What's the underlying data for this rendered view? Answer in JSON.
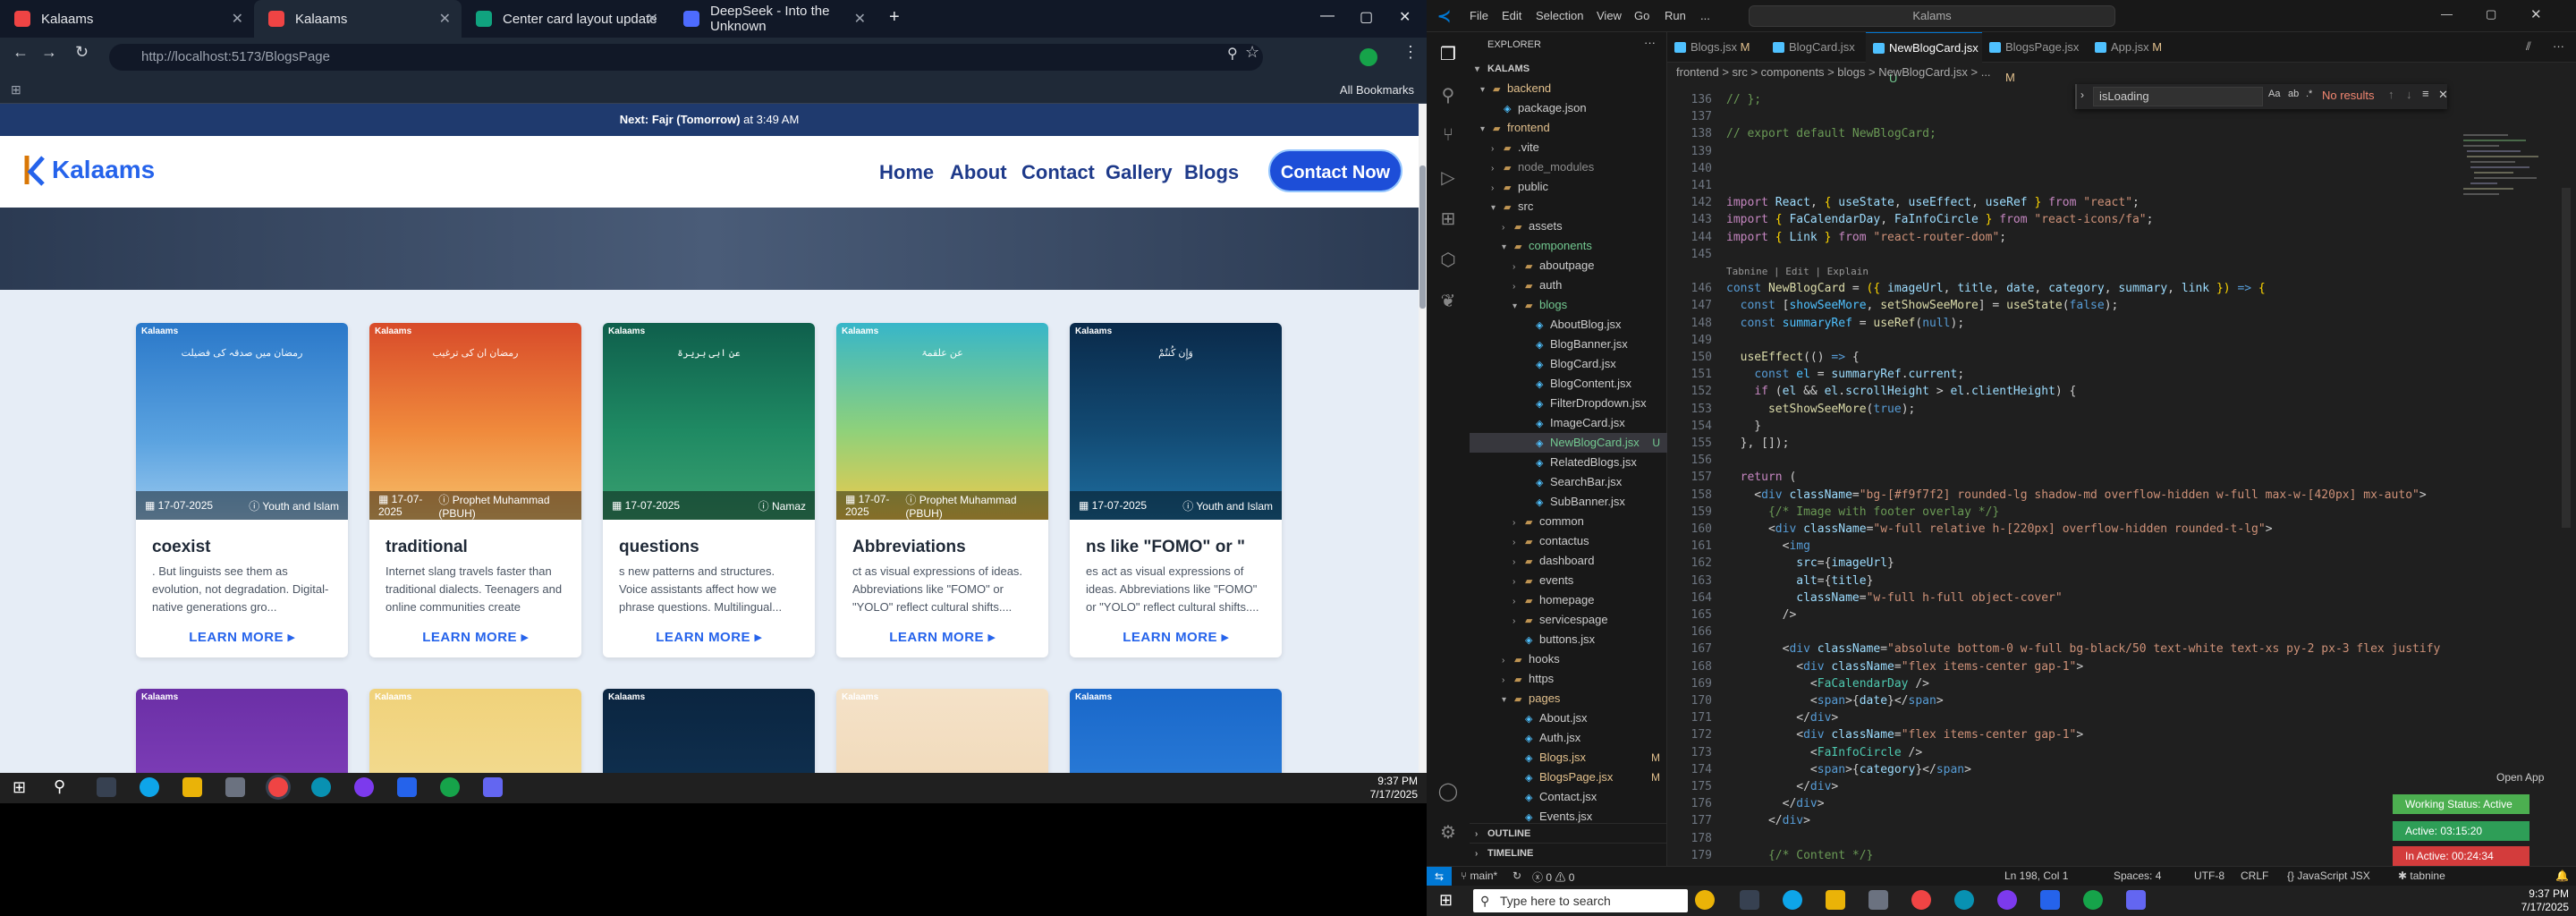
{
  "browser": {
    "tabs": [
      {
        "label": "Kalaams",
        "active": false
      },
      {
        "label": "Kalaams",
        "active": true
      },
      {
        "label": "Center card layout update",
        "active": false
      },
      {
        "label": "DeepSeek - Into the Unknown",
        "active": false
      }
    ],
    "url": "http://localhost:5173/BlogsPage",
    "bookmarks_label": "All Bookmarks"
  },
  "site": {
    "notice_prefix": "Next: Fajr (Tomorrow)",
    "notice_suffix": " at 3:49 AM",
    "logo_text": "Kalaams",
    "nav": [
      "Home",
      "About",
      "Contact",
      "Gallery",
      "Blogs"
    ],
    "contact_button": "Contact Now",
    "learn_more": "LEARN MORE ▸",
    "cards": [
      {
        "title": "coexist",
        "summary": ". But linguists see them as evolution, not degradation. Digital-native generations gro...",
        "date": "17-07-2025",
        "category": "Youth and Islam",
        "arabic": "رمضان میں صدقہ کی فضیلت",
        "bg": "linear-gradient(180deg,#2a78c9,#5ba3e0 60%,#9ac9ef)"
      },
      {
        "title": "traditional",
        "summary": "Internet slang travels faster than traditional dialects. Teenagers and online communities create",
        "date": "17-07-2025",
        "category": "Prophet Muhammad (PBUH)",
        "arabic": "رمضان ان کی ترغیب",
        "bg": "linear-gradient(180deg,#d84b2a,#f08a3c 55%,#f6c06b)"
      },
      {
        "title": "questions",
        "summary": "s new patterns and structures. Voice assistants affect how we phrase questions. Multilingual...",
        "date": "17-07-2025",
        "category": "Namaz",
        "arabic": "عن ابی ہریرۃ",
        "bg": "linear-gradient(180deg,#0f5f4c,#1f8a63 55%,#3aa070)"
      },
      {
        "title": "Abbreviations",
        "summary": "ct as visual expressions of ideas. Abbreviations like \"FOMO\" or \"YOLO\" reflect cultural shifts....",
        "date": "17-07-2025",
        "category": "Prophet Muhammad (PBUH)",
        "arabic": "عن علقمۃ",
        "bg": "linear-gradient(180deg,#37b6c9,#8fd17a 55%,#f3c94a)"
      },
      {
        "title": "ns like \"FOMO\" or \"",
        "summary": "es act as visual expressions of ideas. Abbreviations like \"FOMO\" or \"YOLO\" reflect cultural shifts....",
        "date": "17-07-2025",
        "category": "Youth and Islam",
        "arabic": "وَإِن كُنتُمْ",
        "bg": "linear-gradient(180deg,#0a2a4a,#124a73 55%,#1e6ea0)"
      }
    ],
    "row2_bgs": [
      "linear-gradient(180deg,#6b2fa6,#8f4cc8)",
      "linear-gradient(180deg,#f0d27a,#f6e3a5)",
      "linear-gradient(180deg,#0b2540,#133a5e)",
      "linear-gradient(180deg,#f4e2c8,#efd2ad)",
      "linear-gradient(180deg,#1967c9,#3a8fe6)"
    ]
  },
  "taskbar_left": {
    "time": "9:37 PM",
    "date": "7/17/2025"
  },
  "vscode": {
    "menu": [
      "File",
      "Edit",
      "Selection",
      "View",
      "Go",
      "Run",
      "..."
    ],
    "command_center": "Kalams",
    "explorer_title": "EXPLORER",
    "project": "KALAMS",
    "tabs": [
      {
        "label": "Blogs.jsx",
        "mark": "M",
        "active": false
      },
      {
        "label": "BlogCard.jsx",
        "mark": "",
        "active": false
      },
      {
        "label": "NewBlogCard.jsx",
        "mark": "U",
        "active": true
      },
      {
        "label": "BlogsPage.jsx",
        "mark": "M",
        "active": false
      },
      {
        "label": "App.jsx",
        "mark": "M",
        "active": false
      }
    ],
    "breadcrumb": "frontend > src > components > blogs > NewBlogCard.jsx > ...",
    "find_value": "isLoading",
    "find_result": "No results",
    "tree": [
      {
        "label": "backend",
        "depth": 1,
        "type": "folder",
        "open": true,
        "color": "#e2c08d"
      },
      {
        "label": "package.json",
        "depth": 2,
        "type": "file",
        "open": false,
        "color": "#ccc"
      },
      {
        "label": "frontend",
        "depth": 1,
        "type": "folder",
        "open": true,
        "color": "#e2c08d"
      },
      {
        "label": ".vite",
        "depth": 2,
        "type": "folder",
        "open": false,
        "color": "#ccc"
      },
      {
        "label": "node_modules",
        "depth": 2,
        "type": "folder",
        "open": false,
        "color": "#8b8b8b"
      },
      {
        "label": "public",
        "depth": 2,
        "type": "folder",
        "open": false,
        "color": "#ccc"
      },
      {
        "label": "src",
        "depth": 2,
        "type": "folder",
        "open": true,
        "color": "#ccc"
      },
      {
        "label": "assets",
        "depth": 3,
        "type": "folder",
        "open": false,
        "color": "#ccc"
      },
      {
        "label": "components",
        "depth": 3,
        "type": "folder",
        "open": true,
        "color": "#73c991"
      },
      {
        "label": "aboutpage",
        "depth": 4,
        "type": "folder",
        "open": false,
        "color": "#ccc"
      },
      {
        "label": "auth",
        "depth": 4,
        "type": "folder",
        "open": false,
        "color": "#ccc"
      },
      {
        "label": "blogs",
        "depth": 4,
        "type": "folder",
        "open": true,
        "color": "#73c991"
      },
      {
        "label": "AboutBlog.jsx",
        "depth": 5,
        "type": "file",
        "open": false,
        "color": "#ccc"
      },
      {
        "label": "BlogBanner.jsx",
        "depth": 5,
        "type": "file",
        "open": false,
        "color": "#ccc"
      },
      {
        "label": "BlogCard.jsx",
        "depth": 5,
        "type": "file",
        "open": false,
        "color": "#ccc"
      },
      {
        "label": "BlogContent.jsx",
        "depth": 5,
        "type": "file",
        "open": false,
        "color": "#ccc"
      },
      {
        "label": "FilterDropdown.jsx",
        "depth": 5,
        "type": "file",
        "open": false,
        "color": "#ccc"
      },
      {
        "label": "ImageCard.jsx",
        "depth": 5,
        "type": "file",
        "open": false,
        "color": "#ccc"
      },
      {
        "label": "NewBlogCard.jsx",
        "depth": 5,
        "type": "file",
        "open": false,
        "color": "#73c991",
        "badge": "U",
        "selected": true
      },
      {
        "label": "RelatedBlogs.jsx",
        "depth": 5,
        "type": "file",
        "open": false,
        "color": "#ccc"
      },
      {
        "label": "SearchBar.jsx",
        "depth": 5,
        "type": "file",
        "open": false,
        "color": "#ccc"
      },
      {
        "label": "SubBanner.jsx",
        "depth": 5,
        "type": "file",
        "open": false,
        "color": "#ccc"
      },
      {
        "label": "common",
        "depth": 4,
        "type": "folder",
        "open": false,
        "color": "#ccc"
      },
      {
        "label": "contactus",
        "depth": 4,
        "type": "folder",
        "open": false,
        "color": "#ccc"
      },
      {
        "label": "dashboard",
        "depth": 4,
        "type": "folder",
        "open": false,
        "color": "#ccc"
      },
      {
        "label": "events",
        "depth": 4,
        "type": "folder",
        "open": false,
        "color": "#ccc"
      },
      {
        "label": "homepage",
        "depth": 4,
        "type": "folder",
        "open": false,
        "color": "#ccc"
      },
      {
        "label": "servicespage",
        "depth": 4,
        "type": "folder",
        "open": false,
        "color": "#ccc"
      },
      {
        "label": "buttons.jsx",
        "depth": 4,
        "type": "file",
        "open": false,
        "color": "#ccc"
      },
      {
        "label": "hooks",
        "depth": 3,
        "type": "folder",
        "open": false,
        "color": "#ccc"
      },
      {
        "label": "https",
        "depth": 3,
        "type": "folder",
        "open": false,
        "color": "#ccc"
      },
      {
        "label": "pages",
        "depth": 3,
        "type": "folder",
        "open": true,
        "color": "#e2c08d"
      },
      {
        "label": "About.jsx",
        "depth": 4,
        "type": "file",
        "open": false,
        "color": "#ccc"
      },
      {
        "label": "Auth.jsx",
        "depth": 4,
        "type": "file",
        "open": false,
        "color": "#ccc"
      },
      {
        "label": "Blogs.jsx",
        "depth": 4,
        "type": "file",
        "open": false,
        "color": "#e2c08d",
        "badge": "M"
      },
      {
        "label": "BlogsPage.jsx",
        "depth": 4,
        "type": "file",
        "open": false,
        "color": "#e2c08d",
        "badge": "M"
      },
      {
        "label": "Contact.jsx",
        "depth": 4,
        "type": "file",
        "open": false,
        "color": "#ccc"
      },
      {
        "label": "Events.jsx",
        "depth": 4,
        "type": "file",
        "open": false,
        "color": "#ccc"
      }
    ],
    "outline_label": "OUTLINE",
    "timeline_label": "TIMELINE",
    "code_lines": [
      {
        "n": "136",
        "html": "<span class='cm'>// };</span>"
      },
      {
        "n": "137",
        "html": ""
      },
      {
        "n": "138",
        "html": "<span class='cm'>// export default NewBlogCard;</span>"
      },
      {
        "n": "139",
        "html": ""
      },
      {
        "n": "140",
        "html": ""
      },
      {
        "n": "141",
        "html": ""
      },
      {
        "n": "142",
        "html": "<span class='kw'>import</span> <span class='vr'>React</span>, <span class='br'>{</span> <span class='vr'>useState</span>, <span class='vr'>useEffect</span>, <span class='vr'>useRef</span> <span class='br'>}</span> <span class='kw'>from</span> <span class='st'>\"react\"</span>;"
      },
      {
        "n": "143",
        "html": "<span class='kw'>import</span> <span class='br'>{</span> <span class='vr'>FaCalendarDay</span>, <span class='vr'>FaInfoCircle</span> <span class='br'>}</span> <span class='kw'>from</span> <span class='st'>\"react-icons/fa\"</span>;"
      },
      {
        "n": "144",
        "html": "<span class='kw'>import</span> <span class='br'>{</span> <span class='vr'>Link</span> <span class='br'>}</span> <span class='kw'>from</span> <span class='st'>\"react-router-dom\"</span>;"
      },
      {
        "n": "145",
        "html": ""
      },
      {
        "n": "lens",
        "html": "<span id='lens'>Tabnine | Edit | Explain</span>"
      },
      {
        "n": "146",
        "html": "<span class='kb'>const</span> <span class='fn'>NewBlogCard</span> = <span class='br'>(</span><span class='br'>{</span> <span class='vr'>imageUrl</span>, <span class='vr'>title</span>, <span class='vr'>date</span>, <span class='vr'>category</span>, <span class='vr'>summary</span>, <span class='vr'>link</span> <span class='br'>}</span><span class='br'>)</span> <span class='kb'>=&gt;</span> <span class='br'>{</span>"
      },
      {
        "n": "147",
        "html": "  <span class='kb'>const</span> [<span class='co'>showSeeMore</span>, <span class='fn'>setShowSeeMore</span>] = <span class='fn'>useState</span>(<span class='kb'>false</span>);"
      },
      {
        "n": "148",
        "html": "  <span class='kb'>const</span> <span class='co'>summaryRef</span> = <span class='fn'>useRef</span>(<span class='kb'>null</span>);"
      },
      {
        "n": "149",
        "html": ""
      },
      {
        "n": "150",
        "html": "  <span class='fn'>useEffect</span>(() <span class='kb'>=&gt;</span> {"
      },
      {
        "n": "151",
        "html": "    <span class='kb'>const</span> <span class='co'>el</span> = <span class='vr'>summaryRef</span>.<span class='vr'>current</span>;"
      },
      {
        "n": "152",
        "html": "    <span class='kw'>if</span> (<span class='vr'>el</span> &amp;&amp; <span class='vr'>el</span>.<span class='vr'>scrollHeight</span> &gt; <span class='vr'>el</span>.<span class='vr'>clientHeight</span>) {"
      },
      {
        "n": "153",
        "html": "      <span class='fn'>setShowSeeMore</span>(<span class='kb'>true</span>);"
      },
      {
        "n": "154",
        "html": "    }"
      },
      {
        "n": "155",
        "html": "  }, []);"
      },
      {
        "n": "156",
        "html": ""
      },
      {
        "n": "157",
        "html": "  <span class='kw'>return</span> ("
      },
      {
        "n": "158",
        "html": "    &lt;<span class='kb'>div</span> <span class='at'>className</span>=<span class='st'>\"bg-[#f9f7f2] rounded-lg shadow-md overflow-hidden w-full max-w-[420px] mx-auto\"</span>&gt;"
      },
      {
        "n": "159",
        "html": "      <span class='cm'>{/* Image with footer overlay */}</span>"
      },
      {
        "n": "160",
        "html": "      &lt;<span class='kb'>div</span> <span class='at'>className</span>=<span class='st'>\"w-full relative h-[220px] overflow-hidden rounded-t-lg\"</span>&gt;"
      },
      {
        "n": "161",
        "html": "        &lt;<span class='kb'>img</span>"
      },
      {
        "n": "162",
        "html": "          <span class='at'>src</span>={<span class='vr'>imageUrl</span>}"
      },
      {
        "n": "163",
        "html": "          <span class='at'>alt</span>={<span class='vr'>title</span>}"
      },
      {
        "n": "164",
        "html": "          <span class='at'>className</span>=<span class='st'>\"w-full h-full object-cover\"</span>"
      },
      {
        "n": "165",
        "html": "        /&gt;"
      },
      {
        "n": "166",
        "html": ""
      },
      {
        "n": "167",
        "html": "        &lt;<span class='kb'>div</span> <span class='at'>className</span>=<span class='st'>\"absolute bottom-0 w-full bg-black/50 text-white text-xs py-2 px-3 flex justify</span>"
      },
      {
        "n": "168",
        "html": "          &lt;<span class='kb'>div</span> <span class='at'>className</span>=<span class='st'>\"flex items-center gap-1\"</span>&gt;"
      },
      {
        "n": "169",
        "html": "            &lt;<span class='tg'>FaCalendarDay</span> /&gt;"
      },
      {
        "n": "170",
        "html": "            &lt;<span class='kb'>span</span>&gt;{<span class='vr'>date</span>}&lt;/<span class='kb'>span</span>&gt;"
      },
      {
        "n": "171",
        "html": "          &lt;/<span class='kb'>div</span>&gt;"
      },
      {
        "n": "172",
        "html": "          &lt;<span class='kb'>div</span> <span class='at'>className</span>=<span class='st'>\"flex items-center gap-1\"</span>&gt;"
      },
      {
        "n": "173",
        "html": "            &lt;<span class='tg'>FaInfoCircle</span> /&gt;"
      },
      {
        "n": "174",
        "html": "            &lt;<span class='kb'>span</span>&gt;{<span class='vr'>category</span>}&lt;/<span class='kb'>span</span>&gt;"
      },
      {
        "n": "175",
        "html": "          &lt;/<span class='kb'>div</span>&gt;"
      },
      {
        "n": "176",
        "html": "        &lt;/<span class='kb'>div</span>&gt;"
      },
      {
        "n": "177",
        "html": "      &lt;/<span class='kb'>div</span>&gt;"
      },
      {
        "n": "178",
        "html": ""
      },
      {
        "n": "179",
        "html": "      <span class='cm'>{/* Content */}</span>"
      }
    ],
    "status": {
      "branch": "main*",
      "errors": "0",
      "warnings": "0",
      "position": "Ln 198, Col 1",
      "spaces": "Spaces: 4",
      "encoding": "UTF-8",
      "eol": "CRLF",
      "language": "JavaScript JSX",
      "tabnine": "tabnine"
    },
    "open_app": "Open App",
    "work_status": [
      "Working Status: Active",
      "Active: 03:15:20",
      "In Active: 00:24:34"
    ]
  },
  "taskbar_right": {
    "search_placeholder": "Type here to search",
    "time": "9:37 PM",
    "date": "7/17/2025"
  }
}
